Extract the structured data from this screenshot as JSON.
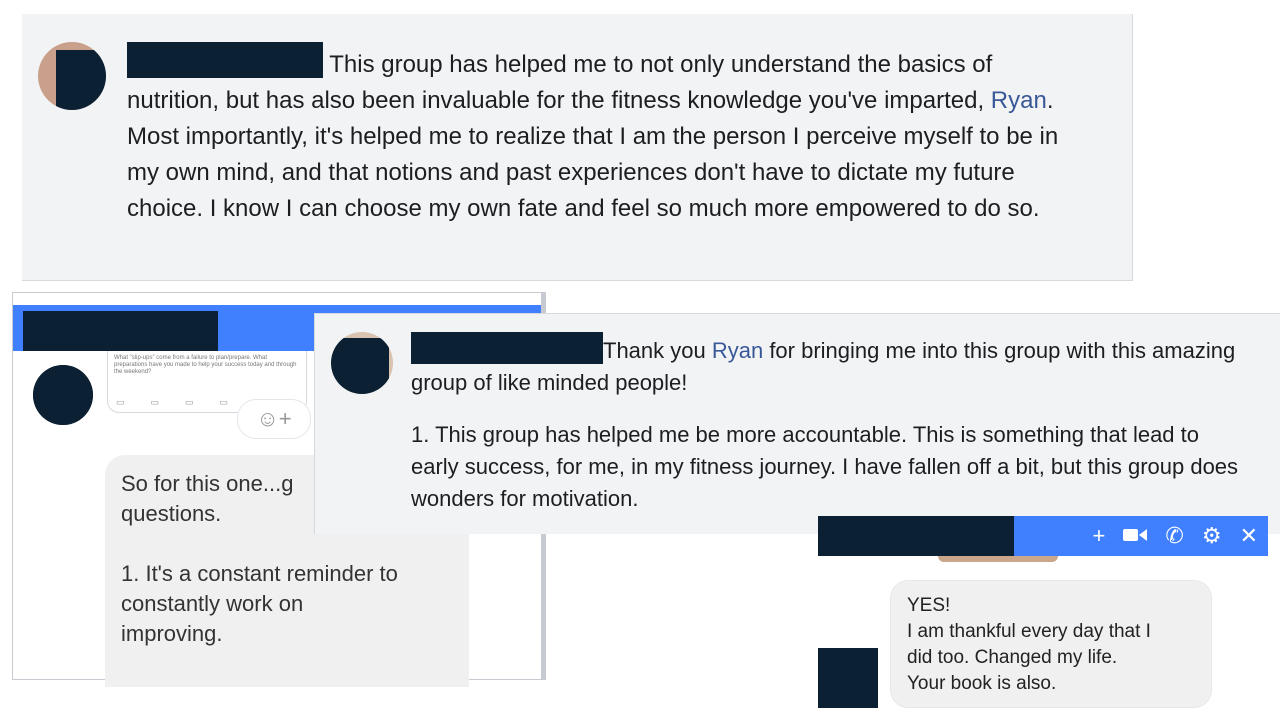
{
  "comment1": {
    "before_link": "This group has helped me to not only understand the basics of nutrition, but has also been invaluable for the fitness knowledge you've imparted, ",
    "link": "Ryan",
    "after_link": ". Most importantly, it's helped me to realize that I am the person I perceive myself to be in my own mind, and that notions and past experiences don't have to dictate my future choice. I know I can choose my own fate and feel so much more empowered to do so."
  },
  "window2": {
    "preview_text": "What \"slip-ups\" come from a failure to plan/prepare. What preparations have you made to help your success today and through the weekend?",
    "emoji_label": "☺+",
    "bubble_lines": [
      "So for this one...g",
      "questions.",
      "",
      "1. It's a constant reminder to",
      "constantly work on",
      "improving."
    ]
  },
  "comment3": {
    "before_link": "Thank you ",
    "link": "Ryan",
    "after_link": " for bringing me into this group with this amazing group of like minded people!",
    "para2": "1. This group has helped me be more accountable. This is something that lead to early success, for me, in my fitness journey. I have fallen off a bit, but this group does wonders for motivation."
  },
  "window4": {
    "tools": [
      "plus-icon",
      "video-icon",
      "phone-icon",
      "gear-icon",
      "close-icon"
    ],
    "bubble_lines": [
      "YES!",
      "I am thankful every day that I",
      "did too. Changed my life.",
      "Your book is also."
    ]
  },
  "colors": {
    "accent": "#4080ff",
    "link": "#385898",
    "redaction": "#0b2033",
    "card_bg": "#f2f3f5",
    "bubble_bg": "#f1f0f0"
  }
}
